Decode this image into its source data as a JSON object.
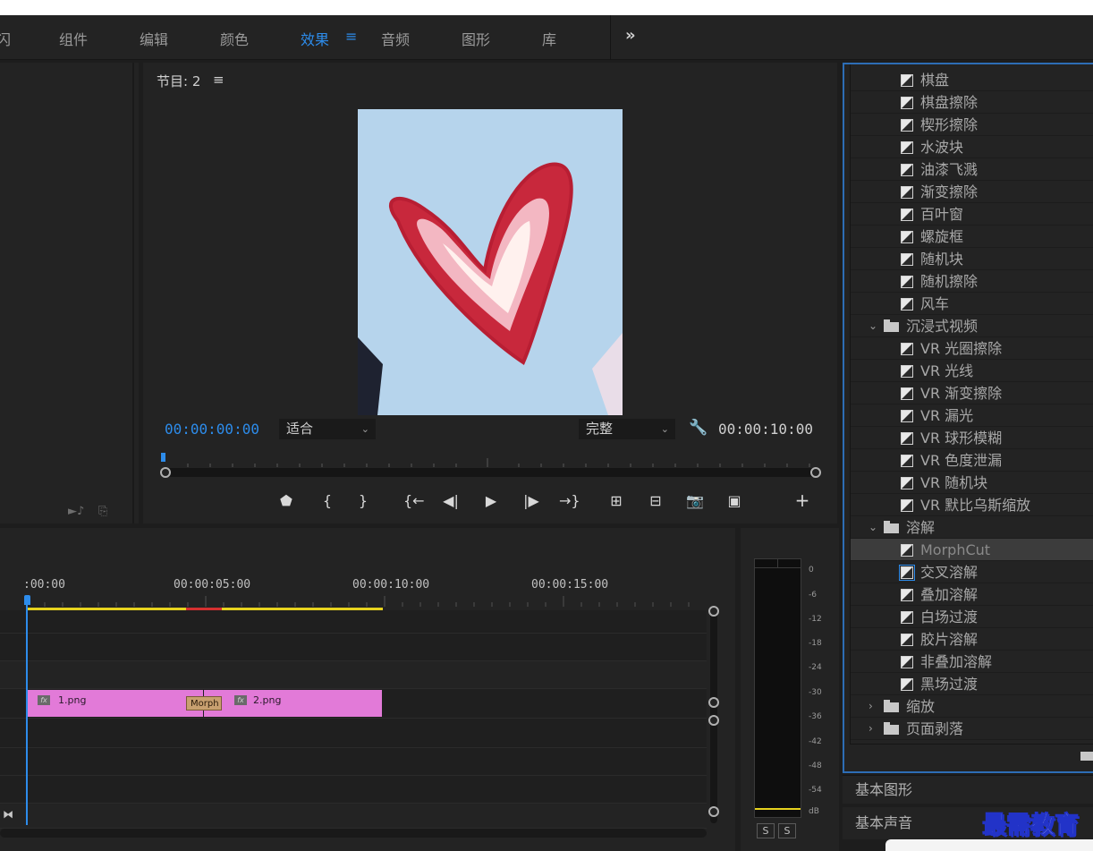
{
  "workspace": {
    "tabs": [
      {
        "label": "闪"
      },
      {
        "label": "组件"
      },
      {
        "label": "编辑"
      },
      {
        "label": "颜色"
      },
      {
        "label": "效果"
      },
      {
        "label": "音频"
      },
      {
        "label": "图形"
      },
      {
        "label": "库"
      }
    ],
    "active_tab": "效果",
    "menu_glyph": "≡",
    "more_glyph": "»",
    "accent_color": "#2d8ceb"
  },
  "program": {
    "title": "节目: 2",
    "menu_glyph": "≡",
    "timecode_current": "00:00:00:00",
    "timecode_duration": "00:00:10:00",
    "fit_select": "适合",
    "quality_select": "完整"
  },
  "controls": {
    "marker": "⬟",
    "mark_in": "{",
    "mark_out": "}",
    "go_in": "{←",
    "step_back": "◀|",
    "play": "▶",
    "step_fwd": "|▶",
    "go_out": "→}",
    "lift": "⊞",
    "extract": "⊟",
    "export_frame": "📷",
    "compare": "▣",
    "add": "+"
  },
  "effects": {
    "items": [
      {
        "kind": "effect",
        "label": "棋盘"
      },
      {
        "kind": "effect",
        "label": "棋盘擦除"
      },
      {
        "kind": "effect",
        "label": "楔形擦除"
      },
      {
        "kind": "effect",
        "label": "水波块"
      },
      {
        "kind": "effect",
        "label": "油漆飞溅"
      },
      {
        "kind": "effect",
        "label": "渐变擦除"
      },
      {
        "kind": "effect",
        "label": "百叶窗"
      },
      {
        "kind": "effect",
        "label": "螺旋框"
      },
      {
        "kind": "effect",
        "label": "随机块"
      },
      {
        "kind": "effect",
        "label": "随机擦除"
      },
      {
        "kind": "effect",
        "label": "风车"
      },
      {
        "kind": "folder",
        "label": "沉浸式视频",
        "caret": "⌄"
      },
      {
        "kind": "effect",
        "label": "VR 光圈擦除"
      },
      {
        "kind": "effect",
        "label": "VR 光线"
      },
      {
        "kind": "effect",
        "label": "VR 渐变擦除"
      },
      {
        "kind": "effect",
        "label": "VR 漏光"
      },
      {
        "kind": "effect",
        "label": "VR 球形模糊"
      },
      {
        "kind": "effect",
        "label": "VR 色度泄漏"
      },
      {
        "kind": "effect",
        "label": "VR 随机块"
      },
      {
        "kind": "effect",
        "label": "VR 默比乌斯缩放"
      },
      {
        "kind": "folder",
        "label": "溶解",
        "caret": "⌄"
      },
      {
        "kind": "effect",
        "label": "MorphCut",
        "selected": true
      },
      {
        "kind": "effect",
        "label": "交叉溶解"
      },
      {
        "kind": "effect",
        "label": "叠加溶解"
      },
      {
        "kind": "effect",
        "label": "白场过渡"
      },
      {
        "kind": "effect",
        "label": "胶片溶解"
      },
      {
        "kind": "effect",
        "label": "非叠加溶解"
      },
      {
        "kind": "effect",
        "label": "黑场过渡"
      },
      {
        "kind": "folder",
        "label": "缩放",
        "caret": "›"
      },
      {
        "kind": "folder",
        "label": "页面剥落",
        "caret": "›"
      }
    ],
    "panel_border_color": "#2d6db5"
  },
  "side_panels": {
    "essential_graphics": "基本图形",
    "essential_sound": "基本声音"
  },
  "timeline": {
    "timecodes": [
      ":00:00",
      "00:00:05:00",
      "00:00:10:00",
      "00:00:15:00"
    ],
    "clips": [
      {
        "fx": "fx",
        "name": "1.png"
      },
      {
        "fx": "fx",
        "name": "2.png"
      }
    ],
    "transition_label": "MorphCut",
    "transition_visible": "Morph",
    "clip_color": "#e27ad8",
    "work_area_color": "#e6d21e",
    "render_red_color": "#d43030"
  },
  "audio_meter": {
    "db_labels": [
      "0",
      "-6",
      "-12",
      "-18",
      "-24",
      "-30",
      "-36",
      "-42",
      "-48",
      "-54",
      "dB"
    ],
    "solo_left": "S",
    "solo_right": "S"
  },
  "watermark": {
    "text": "最需教育"
  }
}
